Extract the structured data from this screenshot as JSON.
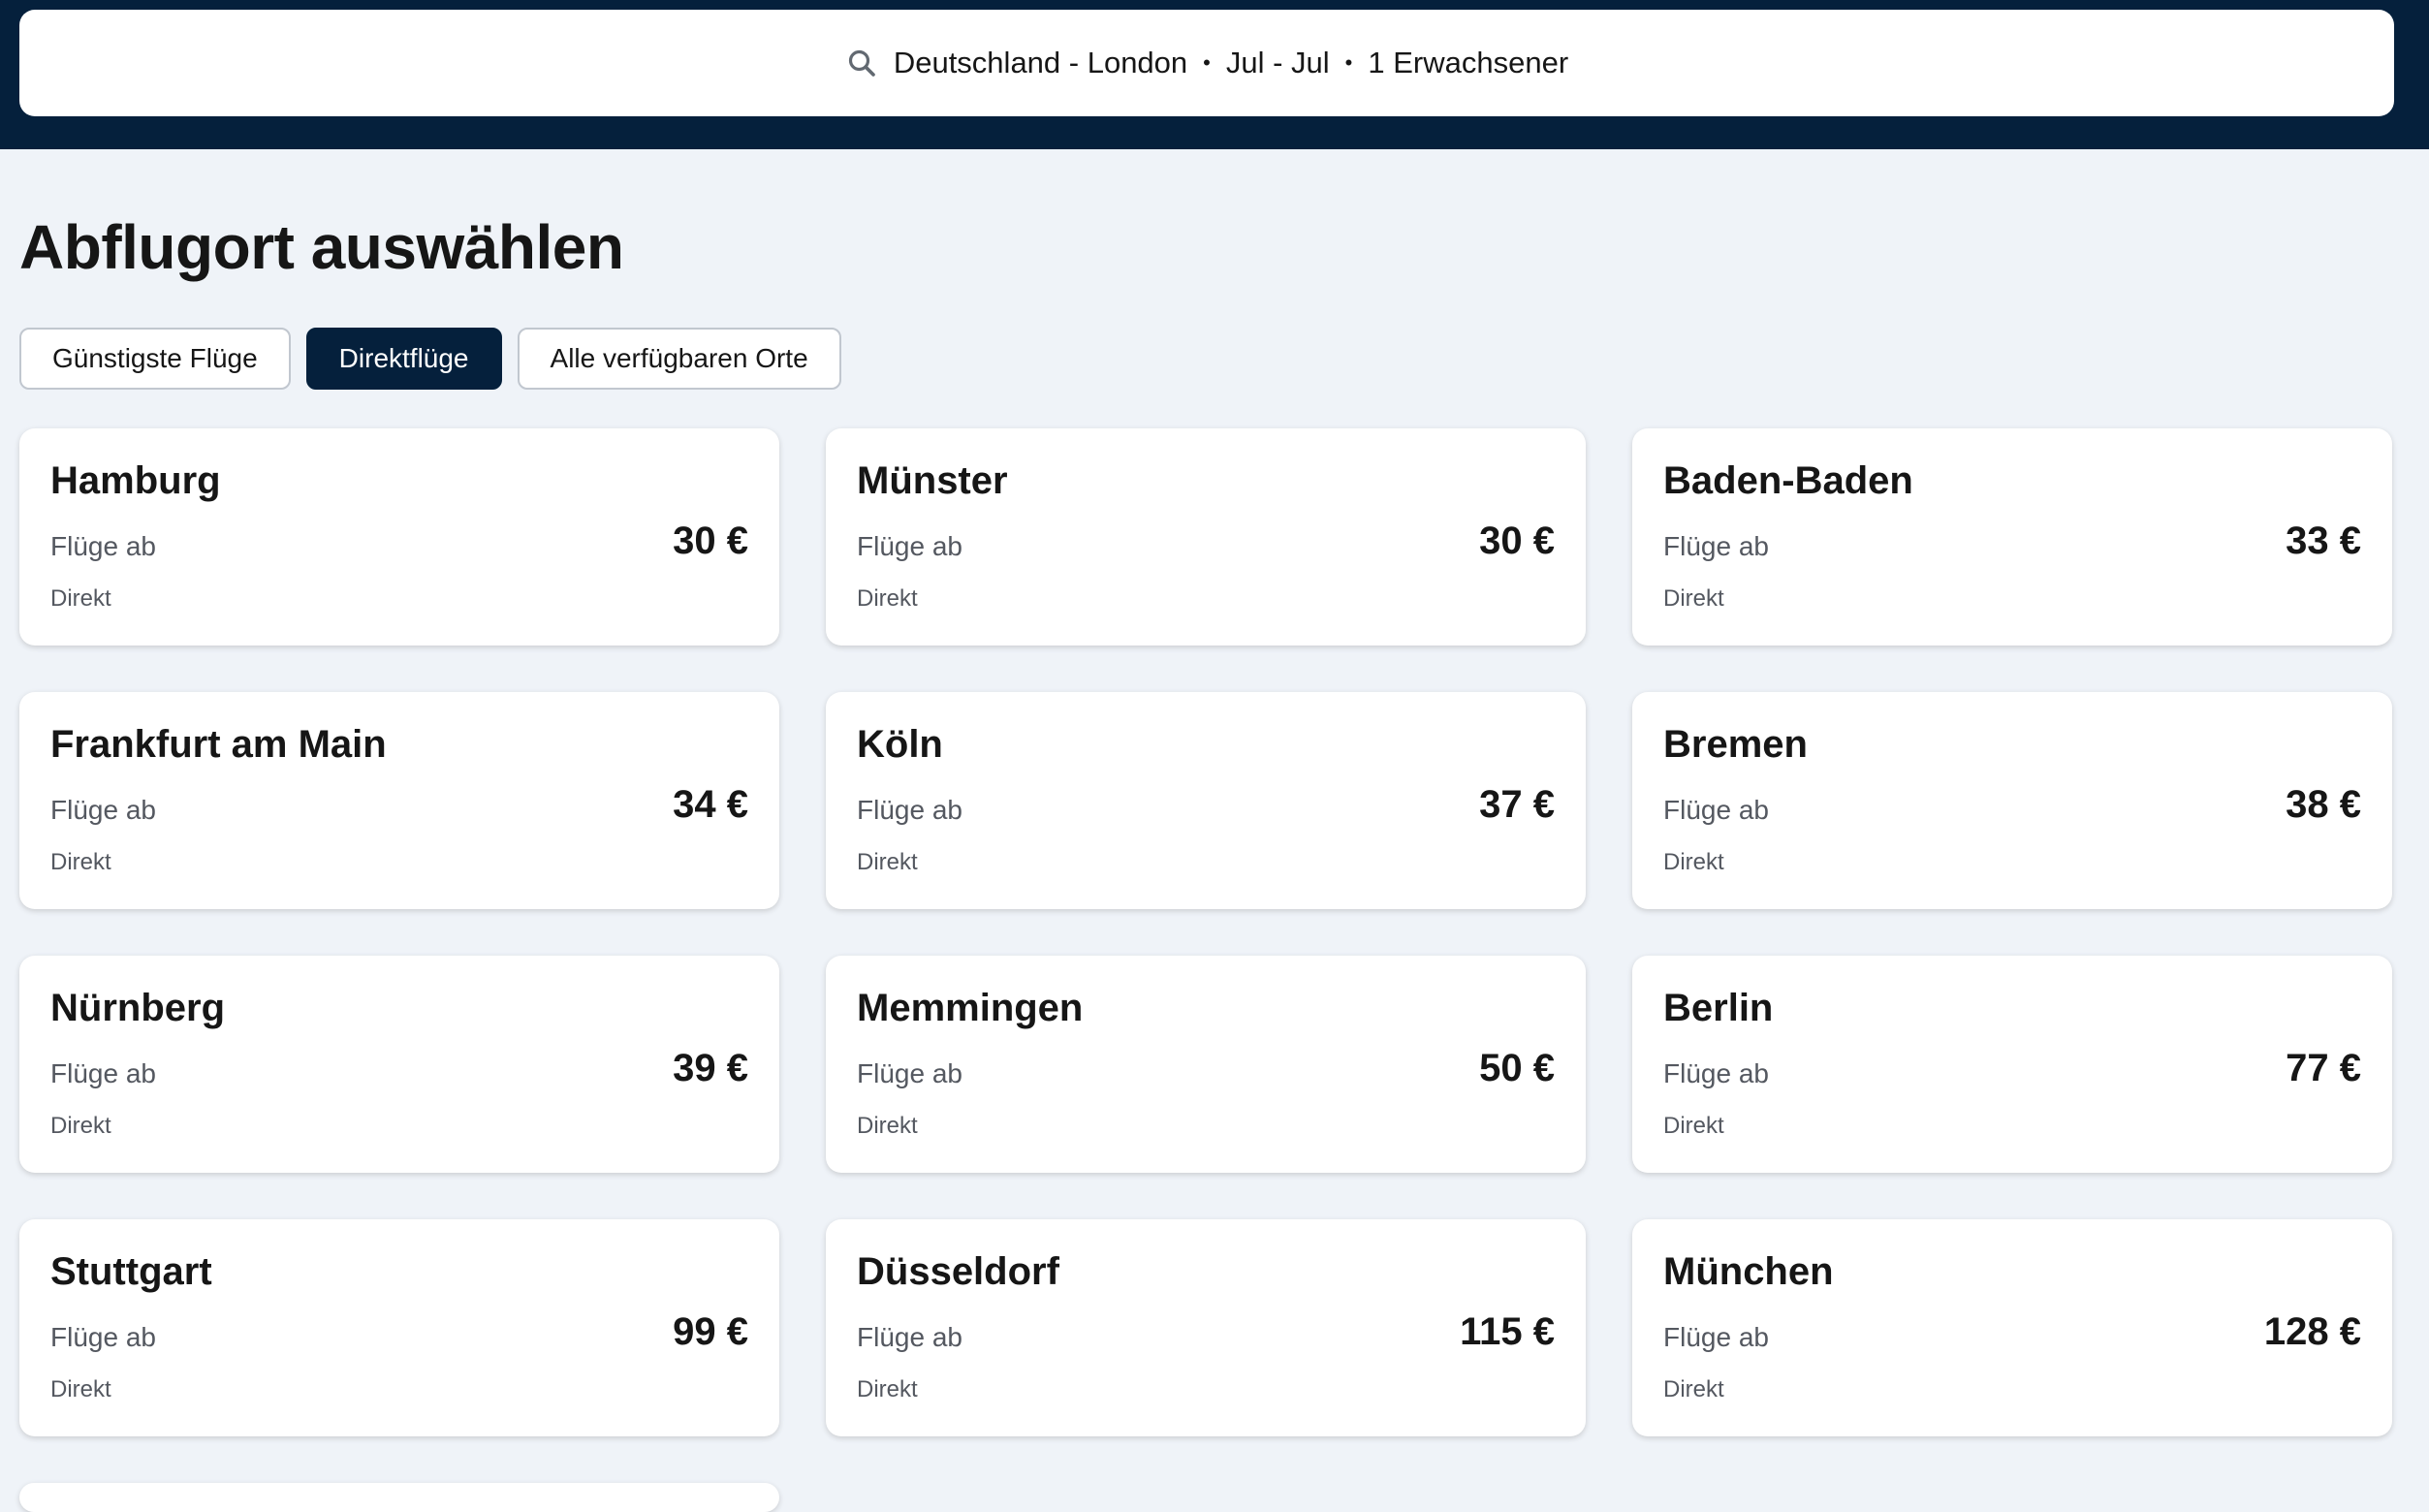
{
  "search": {
    "route": "Deutschland - London",
    "dates": "Jul - Jul",
    "travellers": "1 Erwachsener",
    "separator": "•",
    "icon": "search-icon"
  },
  "page_title": "Abflugort auswählen",
  "filters": [
    {
      "label": "Günstigste Flüge",
      "active": false
    },
    {
      "label": "Direktflüge",
      "active": true
    },
    {
      "label": "Alle verfügbaren Orte",
      "active": false
    }
  ],
  "cards": [
    {
      "city": "Hamburg",
      "subtitle": "Flüge ab",
      "stops": "Direkt",
      "price": "30 €"
    },
    {
      "city": "Münster",
      "subtitle": "Flüge ab",
      "stops": "Direkt",
      "price": "30 €"
    },
    {
      "city": "Baden-Baden",
      "subtitle": "Flüge ab",
      "stops": "Direkt",
      "price": "33 €"
    },
    {
      "city": "Frankfurt am Main",
      "subtitle": "Flüge ab",
      "stops": "Direkt",
      "price": "34 €"
    },
    {
      "city": "Köln",
      "subtitle": "Flüge ab",
      "stops": "Direkt",
      "price": "37 €"
    },
    {
      "city": "Bremen",
      "subtitle": "Flüge ab",
      "stops": "Direkt",
      "price": "38 €"
    },
    {
      "city": "Nürnberg",
      "subtitle": "Flüge ab",
      "stops": "Direkt",
      "price": "39 €"
    },
    {
      "city": "Memmingen",
      "subtitle": "Flüge ab",
      "stops": "Direkt",
      "price": "50 €"
    },
    {
      "city": "Berlin",
      "subtitle": "Flüge ab",
      "stops": "Direkt",
      "price": "77 €"
    },
    {
      "city": "Stuttgart",
      "subtitle": "Flüge ab",
      "stops": "Direkt",
      "price": "99 €"
    },
    {
      "city": "Düsseldorf",
      "subtitle": "Flüge ab",
      "stops": "Direkt",
      "price": "115 €"
    },
    {
      "city": "München",
      "subtitle": "Flüge ab",
      "stops": "Direkt",
      "price": "128 €"
    }
  ],
  "colors": {
    "header_bg": "#05203c",
    "page_bg": "#eff3f8",
    "active_chip_bg": "#05203c",
    "text_primary": "#161616",
    "text_secondary": "#545860"
  }
}
